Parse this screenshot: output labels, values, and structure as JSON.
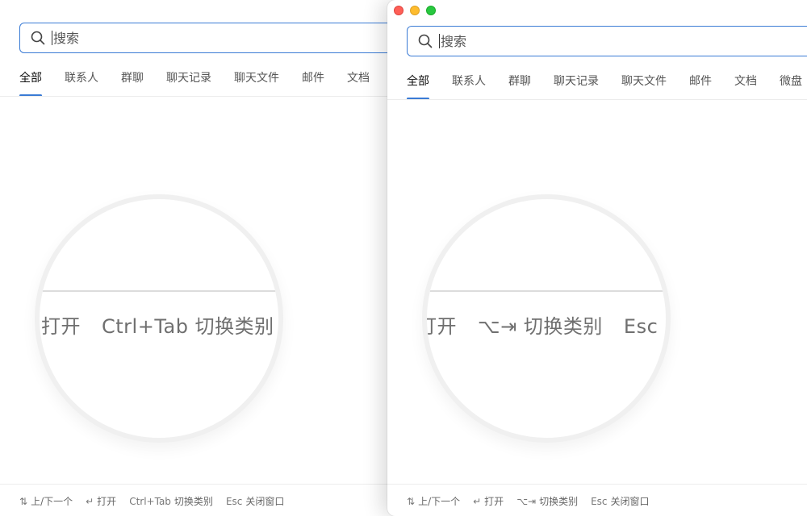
{
  "left": {
    "search": {
      "placeholder": "搜索"
    },
    "tabs": [
      "全部",
      "联系人",
      "群聊",
      "聊天记录",
      "聊天文件",
      "邮件",
      "文档"
    ],
    "footer": [
      {
        "key": "⇅",
        "label": "上/下一个"
      },
      {
        "key": "↵",
        "label": "打开"
      },
      {
        "key": "Ctrl+Tab",
        "label": "切换类别"
      },
      {
        "key": "Esc",
        "label": "关闭窗口"
      }
    ],
    "magnifier": {
      "open": "打开",
      "switch": "Ctrl+Tab 切换类别"
    }
  },
  "right": {
    "search": {
      "placeholder": "搜索"
    },
    "tabs": [
      "全部",
      "联系人",
      "群聊",
      "聊天记录",
      "聊天文件",
      "邮件",
      "文档",
      "微盘"
    ],
    "footer": [
      {
        "key": "⇅",
        "label": "上/下一个"
      },
      {
        "key": "↵",
        "label": "打开"
      },
      {
        "key": "⌥⇥",
        "label": "切换类别"
      },
      {
        "key": "Esc",
        "label": "关闭窗口"
      }
    ],
    "magnifier": {
      "open": "打开",
      "switch": "⌥⇥ 切换类别",
      "esc": "Esc"
    }
  },
  "colors": {
    "accent": "#3a7bd5",
    "close": "#fe5f57",
    "minimize": "#febc2e",
    "zoom": "#28c840"
  }
}
